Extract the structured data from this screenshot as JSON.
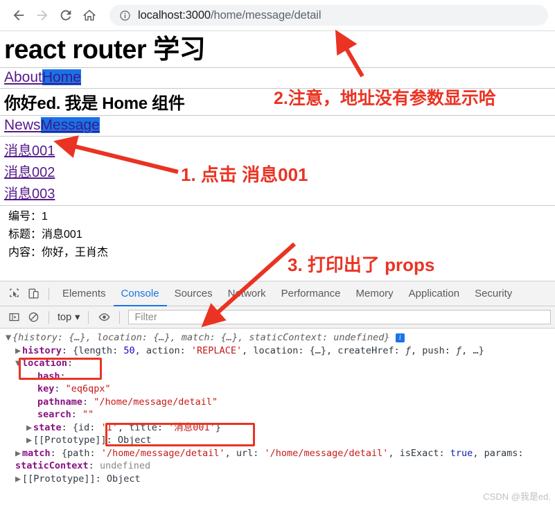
{
  "browser": {
    "back_label": "Back",
    "forward_label": "Forward",
    "reload_label": "Reload",
    "home_label": "Home",
    "site_info_label": "View site information",
    "url_host": "localhost:3000",
    "url_path": "/home/message/detail",
    "url_full": "localhost:3000/home/message/detail"
  },
  "page": {
    "title": "react router 学习",
    "top_nav": [
      {
        "label": "About",
        "selected": false
      },
      {
        "label": "Home",
        "selected": true
      }
    ],
    "greeting": "你好ed. 我是 Home 组件",
    "sub_nav": [
      {
        "label": "News",
        "selected": false
      },
      {
        "label": "Message",
        "selected": true
      }
    ],
    "messages": [
      {
        "label": "消息001"
      },
      {
        "label": "消息002"
      },
      {
        "label": "消息003"
      }
    ],
    "detail": [
      {
        "label": "编号：",
        "value": "1"
      },
      {
        "label": "标题：",
        "value": "消息001"
      },
      {
        "label": "内容：",
        "value": "你好，王肖杰"
      }
    ]
  },
  "annotations": {
    "color": "#ea3323",
    "note1": "1. 点击 消息001",
    "note2": "2.注意，地址没有参数显示哈",
    "note3": "3. 打印出了 props"
  },
  "devtools": {
    "tabs": [
      {
        "label": "Elements",
        "active": false
      },
      {
        "label": "Console",
        "active": true
      },
      {
        "label": "Sources",
        "active": false
      },
      {
        "label": "Network",
        "active": false
      },
      {
        "label": "Performance",
        "active": false
      },
      {
        "label": "Memory",
        "active": false
      },
      {
        "label": "Application",
        "active": false
      },
      {
        "label": "Security",
        "active": false
      }
    ],
    "inspect_icon": "inspect-element-icon",
    "device_icon": "device-toolbar-icon",
    "sidebar_icon": "console-sidebar-icon",
    "clear_icon": "clear-console-icon",
    "eye_icon": "live-expression-icon",
    "context_value": "top",
    "filter_placeholder": "Filter",
    "console": {
      "line0": {
        "preview": "{history: {…}, location: {…}, match: {…}, staticContext: undefined}",
        "history_key": "history",
        "location_key": "location",
        "match_key": "match",
        "staticContext_key": "staticContext",
        "staticContext_value": "undefined"
      },
      "history": {
        "key": "history",
        "length_key": "length",
        "length_value": "50",
        "action_key": "action",
        "action_value": "'REPLACE'",
        "location_key": "location",
        "location_value": "{…}",
        "createHref_key": "createHref",
        "createHref_value": "ƒ",
        "push_key": "push",
        "push_value": "ƒ",
        "ellipsis": "…"
      },
      "location": {
        "key": "location",
        "hash_key": "hash",
        "hash_value": "",
        "key_key": "key",
        "key_value": "\"eq6qpx\"",
        "pathname_key": "pathname",
        "pathname_value": "\"/home/message/detail\"",
        "search_key": "search",
        "search_value": "\"\"",
        "state_key": "state",
        "state_value": "{id: '1', title: '消息001'}",
        "state_id_key": "id",
        "state_id_value": "'1'",
        "state_title_key": "title",
        "state_title_value": "'消息001'",
        "prototype": "[[Prototype]]: Object"
      },
      "match": {
        "key": "match",
        "path_key": "path",
        "path_value": "'/home/message/detail'",
        "url_key": "url",
        "url_value": "'/home/message/detail'",
        "isExact_key": "isExact",
        "isExact_value": "true",
        "params_key": "params"
      },
      "staticContext": {
        "key": "staticContext",
        "value": "undefined"
      },
      "prototype": "[[Prototype]]: Object"
    }
  },
  "watermark": "CSDN @我是ed."
}
